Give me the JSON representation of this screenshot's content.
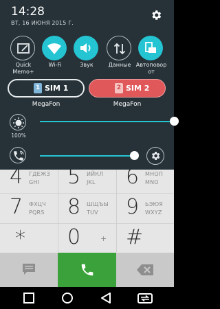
{
  "status_bar": {
    "time": "14:28",
    "date": "ВТ, 16 ИЮНЯ 2015 Г."
  },
  "quick_settings": [
    {
      "label": "Quick\nMemo+",
      "icon": "quick-memo-icon",
      "active": false
    },
    {
      "label": "Wi-Fi",
      "icon": "wifi-icon",
      "active": true
    },
    {
      "label": "Звук",
      "icon": "sound-icon",
      "active": true
    },
    {
      "label": "Данные",
      "icon": "data-icon",
      "active": false
    },
    {
      "label": "Автоповор от",
      "icon": "auto-rotate-icon",
      "active": true
    }
  ],
  "sim_cards": [
    {
      "tag": "1",
      "label": "SIM 1",
      "carrier": "MegaFon",
      "selected": false
    },
    {
      "tag": "2",
      "label": "SIM 2",
      "carrier": "MegaFon",
      "selected": true
    }
  ],
  "brightness": {
    "percent_label": "100%",
    "level": 1.0
  },
  "volume": {
    "level": 0.89
  },
  "dialer": {
    "keys": [
      {
        "num": "4",
        "l1": "ГДЕЖЗ",
        "l2": "GHI"
      },
      {
        "num": "5",
        "l1": "ИЙКЛ",
        "l2": "JKL"
      },
      {
        "num": "6",
        "l1": "МНОП",
        "l2": "MNO"
      },
      {
        "num": "7",
        "l1": "ФХЦЧ",
        "l2": "PQRS"
      },
      {
        "num": "8",
        "l1": "ШЩЪЫ",
        "l2": "TUV"
      },
      {
        "num": "9",
        "l1": "ЬЭЮЯ",
        "l2": "WXYZ"
      },
      {
        "num": "*",
        "l1": "",
        "l2": ""
      },
      {
        "num": "0",
        "l1": "",
        "l2": "",
        "sym": "+"
      },
      {
        "num": "#",
        "l1": "",
        "l2": ""
      }
    ]
  },
  "colors": {
    "shade_bg": "#263238",
    "accent": "#25c4d3",
    "sim2": "#e0585a",
    "call": "#3ba23b"
  }
}
